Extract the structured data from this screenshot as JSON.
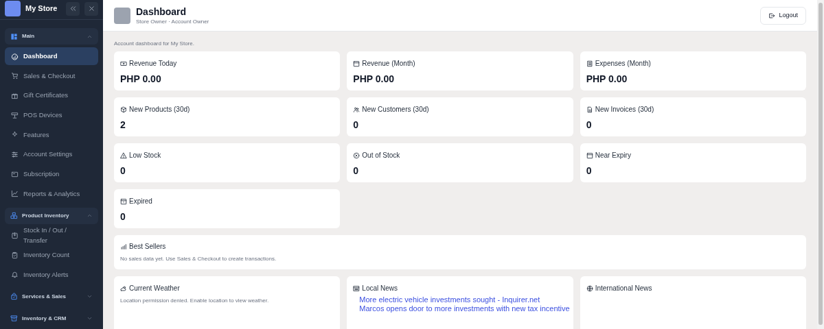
{
  "sidebar": {
    "store_name": "My Store",
    "groups": [
      {
        "label": "Main",
        "expanded": true,
        "items": [
          {
            "label": "Dashboard",
            "selected": true
          },
          {
            "label": "Sales & Checkout",
            "selected": false
          },
          {
            "label": "Gift Certificates",
            "selected": false
          },
          {
            "label": "POS Devices",
            "selected": false
          },
          {
            "label": "Features",
            "selected": false
          },
          {
            "label": "Account Settings",
            "selected": false
          },
          {
            "label": "Subscription",
            "selected": false
          },
          {
            "label": "Reports & Analytics",
            "selected": false
          }
        ]
      },
      {
        "label": "Product Inventory",
        "expanded": true,
        "items": [
          {
            "label": "Stock In / Out / Transfer",
            "selected": false
          },
          {
            "label": "Inventory Count",
            "selected": false
          },
          {
            "label": "Inventory Alerts",
            "selected": false
          }
        ]
      },
      {
        "label": "Services & Sales",
        "expanded": false
      },
      {
        "label": "Inventory & CRM",
        "expanded": false
      }
    ]
  },
  "header": {
    "title": "Dashboard",
    "subtitle": "Store Owner · Account Owner",
    "logout": "Logout"
  },
  "intro": "Account dashboard for My Store.",
  "stat_cards": [
    {
      "label": "Revenue Today",
      "value": "PHP 0.00"
    },
    {
      "label": "Revenue (Month)",
      "value": "PHP 0.00"
    },
    {
      "label": "Expenses (Month)",
      "value": "PHP 0.00"
    },
    {
      "label": "New Products (30d)",
      "value": "2"
    },
    {
      "label": "New Customers (30d)",
      "value": "0"
    },
    {
      "label": "New Invoices (30d)",
      "value": "0"
    },
    {
      "label": "Low Stock",
      "value": "0"
    },
    {
      "label": "Out of Stock",
      "value": "0"
    },
    {
      "label": "Near Expiry",
      "value": "0"
    },
    {
      "label": "Expired",
      "value": "0"
    }
  ],
  "best_sellers": {
    "title": "Best Sellers",
    "message": "No sales data yet. Use Sales & Checkout to create transactions."
  },
  "widgets": [
    {
      "kind": "weather",
      "title": "Current Weather",
      "message": "Location permission denied. Enable location to view weather."
    },
    {
      "kind": "news",
      "title": "Local News",
      "links": [
        "More electric vehicle investments sought - Inquirer.net",
        "Marcos opens door to more investments with new tax incentive"
      ]
    },
    {
      "kind": "news",
      "title": "International News"
    }
  ]
}
